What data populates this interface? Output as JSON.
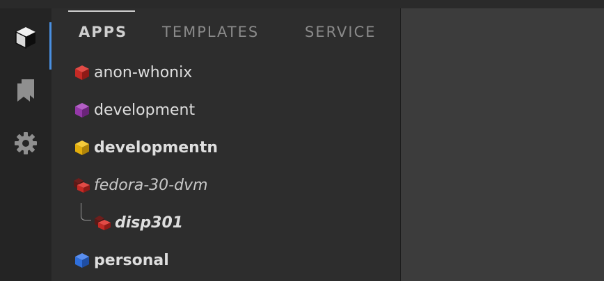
{
  "tabs": [
    {
      "label": "APPS",
      "active": true
    },
    {
      "label": "TEMPLATES",
      "active": false
    },
    {
      "label": "SERVICE",
      "active": false
    }
  ],
  "activity_bar": {
    "items": [
      {
        "icon": "cube-icon",
        "active": true
      },
      {
        "icon": "bookmarks-icon",
        "active": false
      },
      {
        "icon": "gear-icon",
        "active": false
      }
    ]
  },
  "vms": [
    {
      "label": "anon-whonix",
      "color": "#d32a26",
      "style": "normal",
      "kind": "app"
    },
    {
      "label": "development",
      "color": "#9b3bb0",
      "style": "normal",
      "kind": "app"
    },
    {
      "label": "developmentn",
      "color": "#e5b20d",
      "style": "bold",
      "kind": "app"
    },
    {
      "label": "fedora-30-dvm",
      "color": "#c02a26",
      "style": "italic",
      "kind": "dvm-template"
    },
    {
      "label": "disp301",
      "color": "#c02a26",
      "style": "bold-italic",
      "kind": "disposable"
    },
    {
      "label": "personal",
      "color": "#2f6fdb",
      "style": "bold",
      "kind": "app"
    }
  ]
}
